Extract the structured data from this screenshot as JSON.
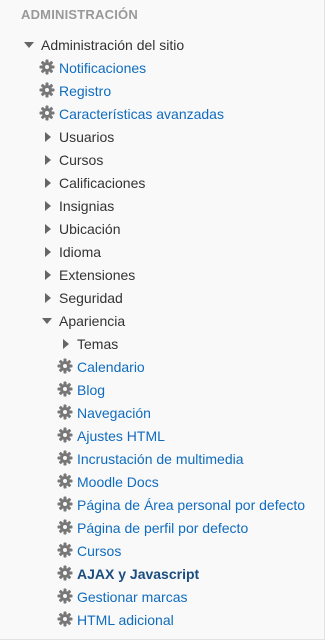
{
  "block": {
    "title": "ADMINISTRACIÓN"
  },
  "tree": {
    "root_label": "Administración del sitio",
    "top_links": [
      "Notificaciones",
      "Registro",
      "Características avanzadas"
    ],
    "categories": [
      "Usuarios",
      "Cursos",
      "Calificaciones",
      "Insignias",
      "Ubicación",
      "Idioma",
      "Extensiones",
      "Seguridad"
    ],
    "apariencia": {
      "label": "Apariencia",
      "sub_category": "Temas",
      "links": [
        "Calendario",
        "Blog",
        "Navegación",
        "Ajustes HTML",
        "Incrustación de multimedia",
        "Moodle Docs",
        "Página de Área personal por defecto",
        "Página de perfil por defecto",
        "Cursos",
        "AJAX y Javascript",
        "Gestionar marcas",
        "HTML adicional"
      ],
      "active_label": "AJAX y Javascript"
    }
  },
  "colors": {
    "link": "#0f6cbf",
    "text": "#333333",
    "title": "#999999",
    "icon": "#777777"
  },
  "icons": {
    "expanded": "triangle-down-icon",
    "collapsed": "triangle-right-icon",
    "setting": "gear-icon"
  }
}
